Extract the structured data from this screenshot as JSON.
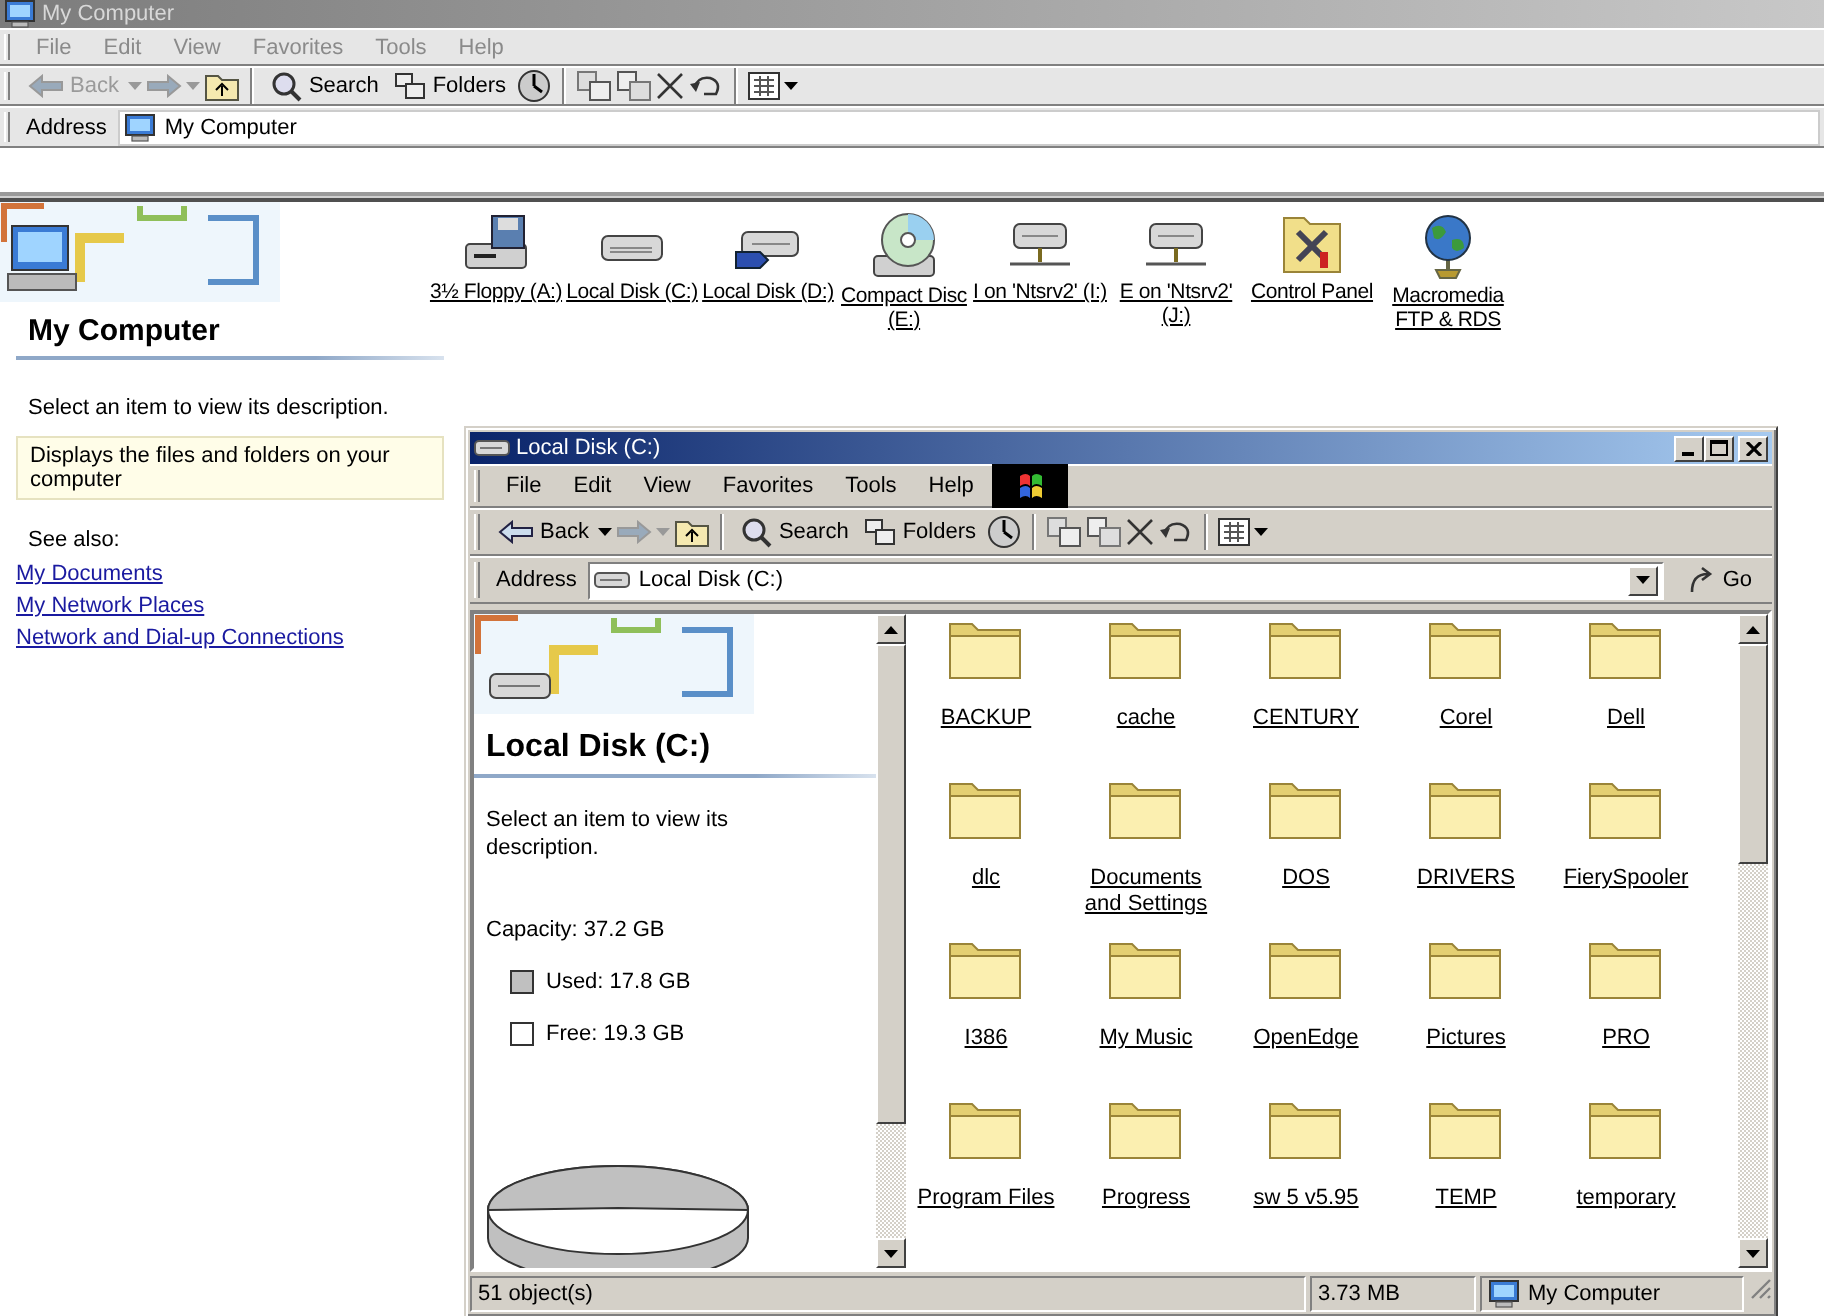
{
  "back_window": {
    "title": "My Computer",
    "active": false,
    "menu": [
      "File",
      "Edit",
      "View",
      "Favorites",
      "Tools",
      "Help"
    ],
    "toolbar": {
      "back": "Back",
      "back_disabled": true,
      "search": "Search",
      "folders": "Folders"
    },
    "address": {
      "label": "Address",
      "value": "My Computer"
    },
    "left_pane": {
      "heading": "My Computer",
      "description": "Select an item to view its description.",
      "info": "Displays the files and folders on your computer",
      "see_also": "See also:",
      "links": [
        "My Documents",
        "My Network Places",
        "Network and Dial-up Connections"
      ]
    },
    "items": [
      {
        "label": "3½ Floppy (A:)",
        "kind": "floppy"
      },
      {
        "label": "Local Disk (C:)",
        "kind": "disk"
      },
      {
        "label": "Local Disk (D:)",
        "kind": "shared_disk"
      },
      {
        "label": "Compact Disc (E:)",
        "kind": "cd"
      },
      {
        "label": "I on 'Ntsrv2' (I:)",
        "kind": "network_drive"
      },
      {
        "label": "E on 'Ntsrv2' (J:)",
        "kind": "network_drive"
      },
      {
        "label": "Control Panel",
        "kind": "control_panel"
      },
      {
        "label": "Macromedia FTP & RDS",
        "kind": "globe"
      }
    ]
  },
  "window": {
    "title": "Local Disk (C:)",
    "active": true,
    "menu": [
      "File",
      "Edit",
      "View",
      "Favorites",
      "Tools",
      "Help"
    ],
    "toolbar": {
      "back": "Back",
      "back_disabled": false,
      "search": "Search",
      "folders": "Folders"
    },
    "address": {
      "label": "Address",
      "value": "Local Disk (C:)",
      "go": "Go"
    },
    "left_pane": {
      "heading": "Local Disk (C:)",
      "description": "Select an item to view its description.",
      "capacity": "Capacity: 37.2 GB",
      "legend": [
        {
          "label": "Used: 17.8 GB",
          "color": "#c0c0c0"
        },
        {
          "label": "Free: 19.3 GB",
          "color": "#ffffff"
        }
      ]
    },
    "folders": [
      "BACKUP",
      "cache",
      "CENTURY",
      "Corel",
      "Dell",
      "dlc",
      "Documents and Settings",
      "DOS",
      "DRIVERS",
      "FierySpooler",
      "I386",
      "My Music",
      "OpenEdge",
      "Pictures",
      "PRO",
      "Program Files",
      "Progress",
      "sw 5 v5.95",
      "TEMP",
      "temporary"
    ],
    "status_bar": {
      "objects": "51 object(s)",
      "size": "3.73 MB",
      "zone": "My Computer"
    }
  }
}
